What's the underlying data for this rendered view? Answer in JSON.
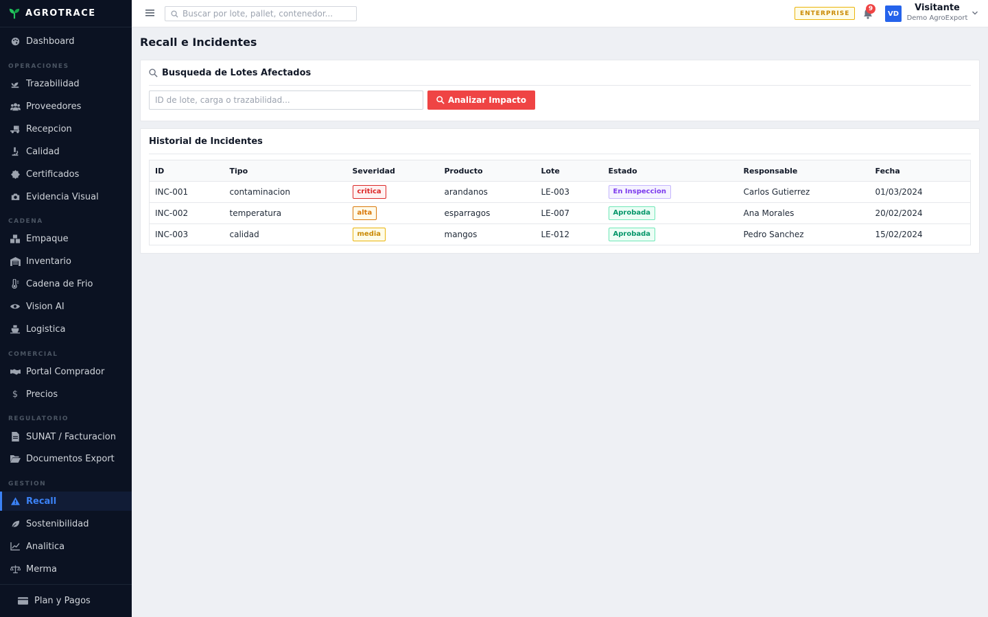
{
  "brand": {
    "name": "AGROTRACE"
  },
  "sidebar": {
    "dashboard": "Dashboard",
    "sections": {
      "operaciones": "OPERACIONES",
      "cadena": "CADENA",
      "comercial": "COMERCIAL",
      "regulatorio": "REGULATORIO",
      "gestion": "GESTION"
    },
    "items": {
      "trazabilidad": "Trazabilidad",
      "proveedores": "Proveedores",
      "recepcion": "Recepcion",
      "calidad": "Calidad",
      "certificados": "Certificados",
      "evidencia": "Evidencia Visual",
      "empaque": "Empaque",
      "inventario": "Inventario",
      "cadena_frio": "Cadena de Frio",
      "vision": "Vision AI",
      "logistica": "Logistica",
      "portal": "Portal Comprador",
      "precios": "Precios",
      "sunat": "SUNAT / Facturacion",
      "documentos": "Documentos Export",
      "recall": "Recall",
      "sostenibilidad": "Sostenibilidad",
      "analitica": "Analitica",
      "merma": "Merma"
    },
    "footer": "Plan y Pagos"
  },
  "topbar": {
    "search_placeholder": "Buscar por lote, pallet, contenedor...",
    "plan_badge": "ENTERPRISE",
    "notifications": "9",
    "avatar": "VD",
    "user_name": "Visitante",
    "user_org": "Demo AgroExport"
  },
  "page": {
    "title": "Recall e Incidentes",
    "search_card": {
      "title": "Busqueda de Lotes Afectados",
      "input_placeholder": "ID de lote, carga o trazabilidad...",
      "button": "Analizar Impacto"
    },
    "history": {
      "title": "Historial de Incidentes",
      "headers": {
        "id": "ID",
        "tipo": "Tipo",
        "severidad": "Severidad",
        "producto": "Producto",
        "lote": "Lote",
        "estado": "Estado",
        "responsable": "Responsable",
        "fecha": "Fecha"
      },
      "rows": [
        {
          "id": "INC-001",
          "tipo": "contaminacion",
          "severidad": "critica",
          "producto": "arandanos",
          "lote": "LE-003",
          "estado": "En Inspeccion",
          "responsable": "Carlos Gutierrez",
          "fecha": "01/03/2024"
        },
        {
          "id": "INC-002",
          "tipo": "temperatura",
          "severidad": "alta",
          "producto": "esparragos",
          "lote": "LE-007",
          "estado": "Aprobada",
          "responsable": "Ana Morales",
          "fecha": "20/02/2024"
        },
        {
          "id": "INC-003",
          "tipo": "calidad",
          "severidad": "media",
          "producto": "mangos",
          "lote": "LE-012",
          "estado": "Aprobada",
          "responsable": "Pedro Sanchez",
          "fecha": "15/02/2024"
        }
      ]
    }
  },
  "colors": {
    "accent": "#3b82f6",
    "danger": "#ef4444",
    "critica": "#dc2626",
    "alta": "#d97706",
    "media": "#ca8a04",
    "inspeccion": "#7c3aed",
    "aprobada": "#059669"
  }
}
